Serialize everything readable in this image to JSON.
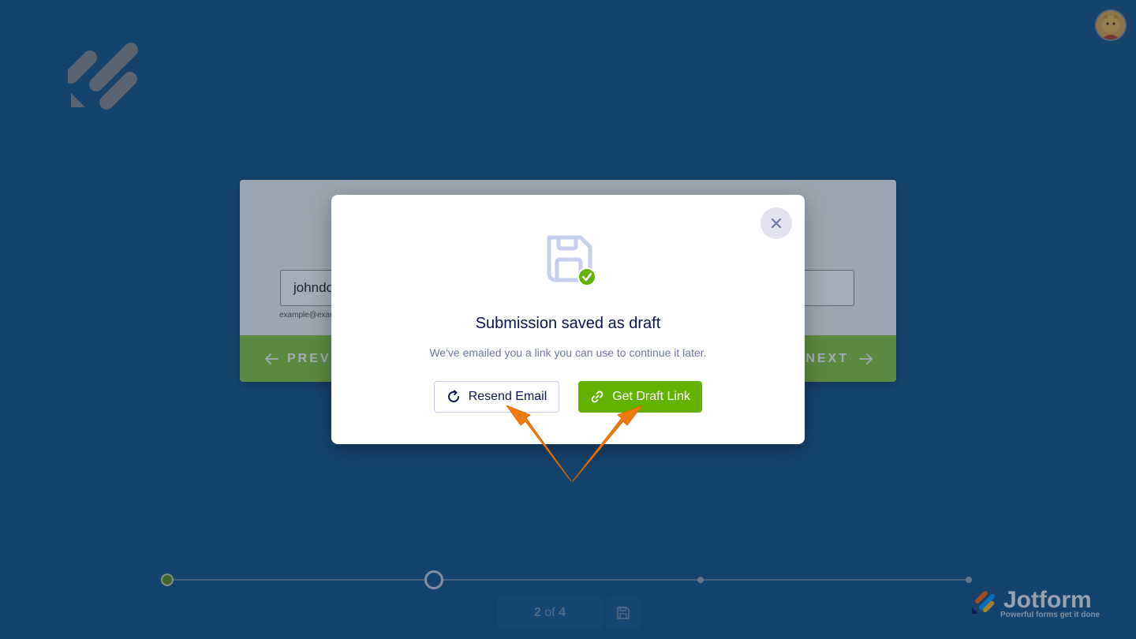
{
  "form": {
    "email_value": "johndoe",
    "email_sublabel": "example@example.com",
    "prev_label": "PREVIOUS",
    "next_label": "NEXT"
  },
  "progress": {
    "current_page": 2,
    "total_pages": 4,
    "counter_current": "2",
    "counter_of": "of",
    "counter_total": "4"
  },
  "modal": {
    "title": "Submission saved as draft",
    "subtitle": "We've emailed you a link you can use to continue it later.",
    "resend_label": "Resend Email",
    "draft_link_label": "Get Draft Link",
    "icons": {
      "close": "close-icon",
      "saved": "floppy-disk-icon",
      "check": "check-icon",
      "resend": "refresh-icon",
      "link": "link-icon"
    }
  },
  "branding": {
    "name": "Jotform",
    "tagline": "Powerful forms get it done"
  },
  "colors": {
    "background": "#1a5484",
    "accent_green": "#64b200",
    "footer_green": "#8cc63f",
    "navy_text": "#0a1551",
    "annotation_orange": "#f07b10"
  }
}
